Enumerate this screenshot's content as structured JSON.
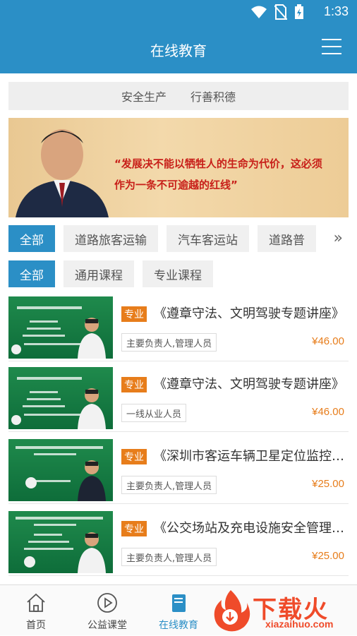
{
  "status": {
    "time": "1:33"
  },
  "header": {
    "title": "在线教育"
  },
  "motto": {
    "left": "安全生产",
    "right": "行善积德"
  },
  "banner": {
    "quote_line1": "“发展决不能以牺牲人的生命为代价，这必须",
    "quote_line2": "作为一条不可逾越的红线”"
  },
  "category_filters": [
    "全部",
    "道路旅客运输",
    "汽车客运站",
    "道路普"
  ],
  "type_filters": [
    "全部",
    "通用课程",
    "专业课程"
  ],
  "more_icon": "double-chevron-right",
  "courses": [
    {
      "tag": "专业",
      "title": "《遵章守法、文明驾驶专题讲座》",
      "audience": "主要负责人,管理人员",
      "price": "¥46.00"
    },
    {
      "tag": "专业",
      "title": "《遵章守法、文明驾驶专题讲座》",
      "audience": "一线从业人员",
      "price": "¥46.00"
    },
    {
      "tag": "专业",
      "title": "《深圳市客运车辆卫星定位监控系统》",
      "audience": "主要负责人,管理人员",
      "price": "¥25.00"
    },
    {
      "tag": "专业",
      "title": "《公交场站及充电设施安全管理要点》",
      "audience": "主要负责人,管理人员",
      "price": "¥25.00"
    }
  ],
  "tabbar": {
    "home": "首页",
    "public": "公益课堂",
    "online": "在线教育"
  },
  "watermark": {
    "text": "下载火",
    "url": "xiazaihuo.com"
  },
  "colors": {
    "primary": "#2b8fc6",
    "accent": "#e77d1b",
    "quote_red": "#c8201a"
  }
}
